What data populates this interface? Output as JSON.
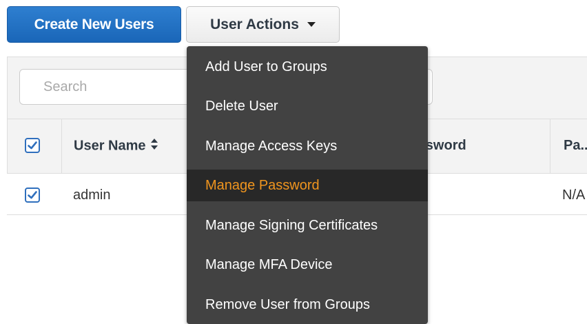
{
  "toolbar": {
    "create_label": "Create New Users",
    "actions_label": "User Actions"
  },
  "search": {
    "placeholder": "Search",
    "value": ""
  },
  "table": {
    "columns": [
      "User Name",
      "...ssword",
      "Pa..."
    ],
    "header_checkbox_checked": true,
    "rows": [
      {
        "checked": true,
        "user_name": "admin",
        "last_col": "N/A"
      }
    ]
  },
  "menu": {
    "items": [
      {
        "label": "Add User to Groups",
        "active": false
      },
      {
        "label": "Delete User",
        "active": false
      },
      {
        "label": "Manage Access Keys",
        "active": false
      },
      {
        "label": "Manage Password",
        "active": true
      },
      {
        "label": "Manage Signing Certificates",
        "active": false
      },
      {
        "label": "Manage MFA Device",
        "active": false
      },
      {
        "label": "Remove User from Groups",
        "active": false
      }
    ]
  },
  "colors": {
    "primary_button": "#1f6fc0",
    "menu_background": "#424242",
    "menu_active_text": "#f0951e",
    "checkbox_accent": "#2f6fbd"
  },
  "icons": {
    "caret": "caret-down-icon",
    "sort": "sort-icon",
    "checkbox": "checkmark-icon"
  }
}
